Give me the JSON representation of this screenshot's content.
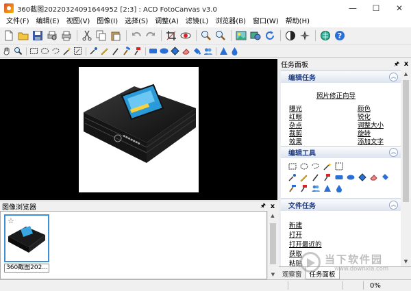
{
  "window": {
    "title": "360截图20220324091644952 [2:3] : ACD FotoCanvas v3.0",
    "minimize_glyph": "—",
    "maximize_glyph": "☐",
    "close_glyph": "✕"
  },
  "menu": [
    "文件(F)",
    "编辑(E)",
    "视图(V)",
    "图像(I)",
    "选择(S)",
    "调整(A)",
    "滤镜(L)",
    "浏览器(B)",
    "窗口(W)",
    "帮助(H)"
  ],
  "toolbar_icons": [
    "new-file-icon",
    "open-folder-icon",
    "save-icon",
    "print-preview-icon",
    "print-icon",
    "cut-icon",
    "copy-icon",
    "paste-icon",
    "undo-icon",
    "redo-icon",
    "crop-icon",
    "red-eye-icon",
    "zoom-in-icon",
    "zoom-out-icon",
    "photo-frame-icon",
    "web-gallery-icon",
    "rotate-icon",
    "contrast-icon",
    "sharpen-icon",
    "web-update-icon",
    "help-icon"
  ],
  "tools_icons": [
    "hand-icon",
    "zoom-icon",
    "rect-select-icon",
    "ellipse-select-icon",
    "lasso-icon",
    "magic-wand-icon",
    "auto-select-icon",
    "eyedropper-icon",
    "pencil-icon",
    "brush-icon",
    "hammer-icon",
    "pin-icon",
    "rect-shape-icon",
    "ellipse-shape-icon",
    "diamond-icon",
    "eraser-icon",
    "fill-icon",
    "clone-icon",
    "sharpen-tool-icon",
    "drop-icon"
  ],
  "image_browser": {
    "title": "图像浏览器",
    "pin_glyph": "🖈",
    "close_glyph": "x",
    "thumbnail_caption": "360截图202...",
    "star_glyph": "☆"
  },
  "task_panel": {
    "title": "任务面板",
    "pin_glyph": "🖈",
    "close_glyph": "x",
    "collapse_glyph": "︽",
    "edit_tasks": {
      "title": "编辑任务",
      "wizard": "照片修正向导",
      "left_links": [
        "曝光",
        "红眼",
        "杂点",
        "裁剪",
        "效果"
      ],
      "right_links": [
        "颜色",
        "锐化",
        "调整大小",
        "旋转",
        "添加文字"
      ]
    },
    "edit_tools": {
      "title": "编辑工具"
    },
    "file_tasks": {
      "title": "文件任务",
      "links": [
        "新建",
        "打开",
        "打开最近的",
        "获取",
        "粘贴"
      ]
    },
    "tabs": [
      "观察窗",
      "任务面板"
    ]
  },
  "status": {
    "zoom": "0%"
  },
  "watermark": {
    "text": "当下软件园",
    "url": "www.downxia.com"
  },
  "colors": {
    "accent": "#3c8fd6",
    "section_title": "#1f3d8a"
  }
}
